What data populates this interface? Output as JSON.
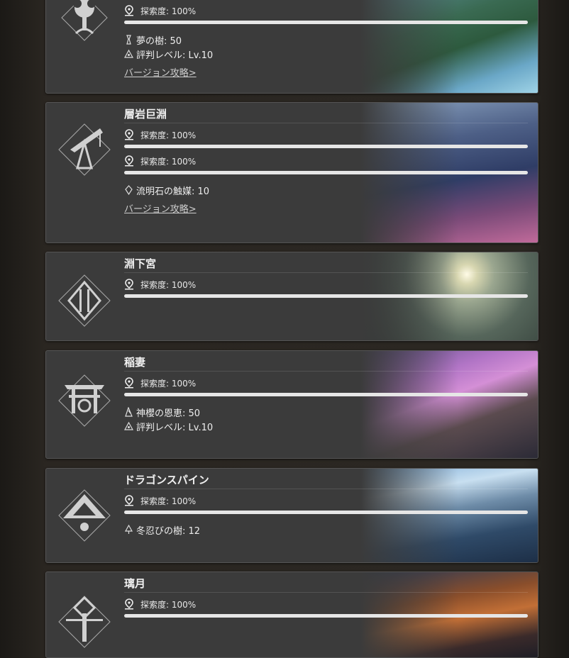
{
  "regions": [
    {
      "title": "",
      "explorations": [
        {
          "label": "探索度: 100%",
          "progress": 1.0
        }
      ],
      "stats": [
        {
          "icon": "tree-offering-icon",
          "text": "夢の樹: 50"
        },
        {
          "icon": "reputation-icon",
          "text": "評判レベル: Lv.10"
        }
      ],
      "link": "バージョン攻略>",
      "emblem": "sumeru-emblem-icon"
    },
    {
      "title": "層岩巨淵",
      "explorations": [
        {
          "label": "探索度: 100%",
          "progress": 1.0
        },
        {
          "label": "探索度: 100%",
          "progress": 1.0
        }
      ],
      "stats": [
        {
          "icon": "lumenstone-icon",
          "text": "流明石の触媒: 10"
        }
      ],
      "link": "バージョン攻略>",
      "emblem": "chasm-emblem-icon"
    },
    {
      "title": "淵下宮",
      "explorations": [
        {
          "label": "探索度: 100%",
          "progress": 1.0
        }
      ],
      "stats": [],
      "link": "",
      "emblem": "enkanomiya-emblem-icon"
    },
    {
      "title": "稲妻",
      "explorations": [
        {
          "label": "探索度: 100%",
          "progress": 1.0
        }
      ],
      "stats": [
        {
          "icon": "sacred-sakura-icon",
          "text": "神櫻の恩恵: 50"
        },
        {
          "icon": "reputation-icon",
          "text": "評判レベル: Lv.10"
        }
      ],
      "link": "",
      "emblem": "inazuma-emblem-icon"
    },
    {
      "title": "ドラゴンスパイン",
      "explorations": [
        {
          "label": "探索度: 100%",
          "progress": 1.0
        }
      ],
      "stats": [
        {
          "icon": "frostbearing-tree-icon",
          "text": "冬忍びの樹: 12"
        }
      ],
      "link": "",
      "emblem": "dragonspine-emblem-icon"
    },
    {
      "title": "璃月",
      "explorations": [
        {
          "label": "探索度: 100%",
          "progress": 1.0
        }
      ],
      "stats": [],
      "link": "",
      "emblem": "liyue-emblem-icon"
    }
  ]
}
